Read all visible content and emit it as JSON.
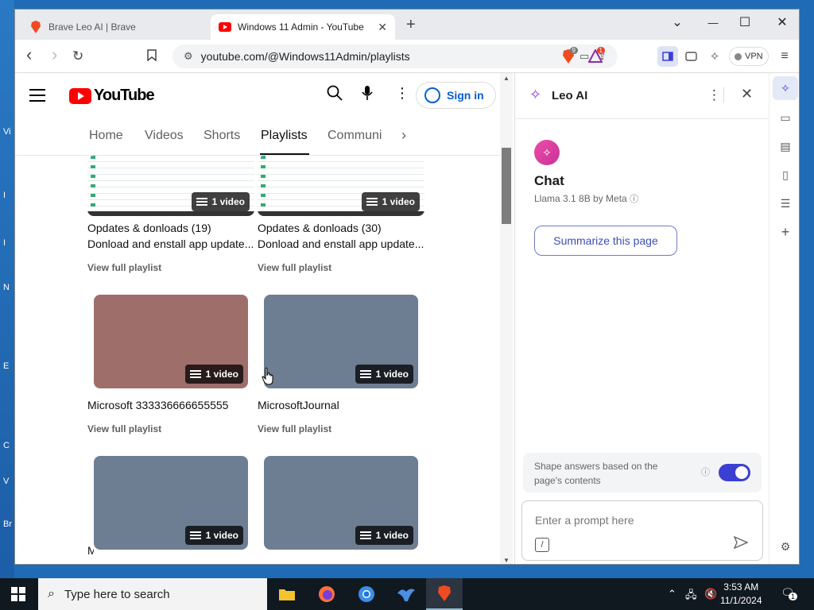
{
  "desktop": {
    "edge_labels": [
      "Vi",
      "I",
      "I",
      "N",
      "E",
      "C",
      "V",
      "Br"
    ]
  },
  "browser": {
    "tabs": [
      {
        "label": "Brave Leo AI | Brave",
        "icon": "brave-lion-icon"
      },
      {
        "label": "Windows 11 Admin - YouTube",
        "icon": "youtube-icon",
        "close": "✕"
      }
    ],
    "new_tab": "+",
    "window_controls": {
      "dropdown": "⌄",
      "minimize": "—",
      "maximize": "☐",
      "close": "✕"
    },
    "toolbar": {
      "back": "‹",
      "forward": "›",
      "reload": "↻",
      "url": "youtube.com/@Windows11Admin/playlists"
    },
    "shields_count": "9",
    "rewards_count": "1",
    "vpn_label": "VPN"
  },
  "youtube": {
    "logo_text": "YouTube",
    "sign_in": "Sign in",
    "nav_tabs": [
      "Home",
      "Videos",
      "Shorts",
      "Playlists",
      "Communi"
    ],
    "active_tab": "Playlists",
    "playlists": [
      {
        "title": "Opdates & donloads (19)",
        "subtitle": "Donload and enstall app update...",
        "count": "1 video",
        "link": "View full playlist",
        "thumb": "#f2f6f2"
      },
      {
        "title": "Opdates & donloads (30)",
        "subtitle": "Donload and enstall app update...",
        "count": "1 video",
        "link": "View full playlist",
        "thumb": "#f2f6f2"
      },
      {
        "title": "Microsoft 333336666655555",
        "count": "1 video",
        "link": "View full playlist",
        "thumb": "#9e6e6a"
      },
      {
        "title": "MicrosoftJournal",
        "count": "1 video",
        "link": "View full playlist",
        "thumb": "#6e7e92"
      },
      {
        "title": "M",
        "count": "1 video",
        "thumb": "#6e7e92"
      },
      {
        "count": "1 video",
        "thumb": "#6e7e92"
      }
    ]
  },
  "leo": {
    "title": "Leo AI",
    "chat_title": "Chat",
    "model": "Llama 3.1 8B by Meta",
    "summarize": "Summarize this page",
    "shape_text": "Shape answers based on the page's contents",
    "shape_enabled": true,
    "prompt_placeholder": "Enter a prompt here",
    "slash": "/"
  },
  "taskbar": {
    "search_placeholder": "Type here to search",
    "time": "3:53 AM",
    "date": "11/1/2024",
    "notifications": "1"
  }
}
